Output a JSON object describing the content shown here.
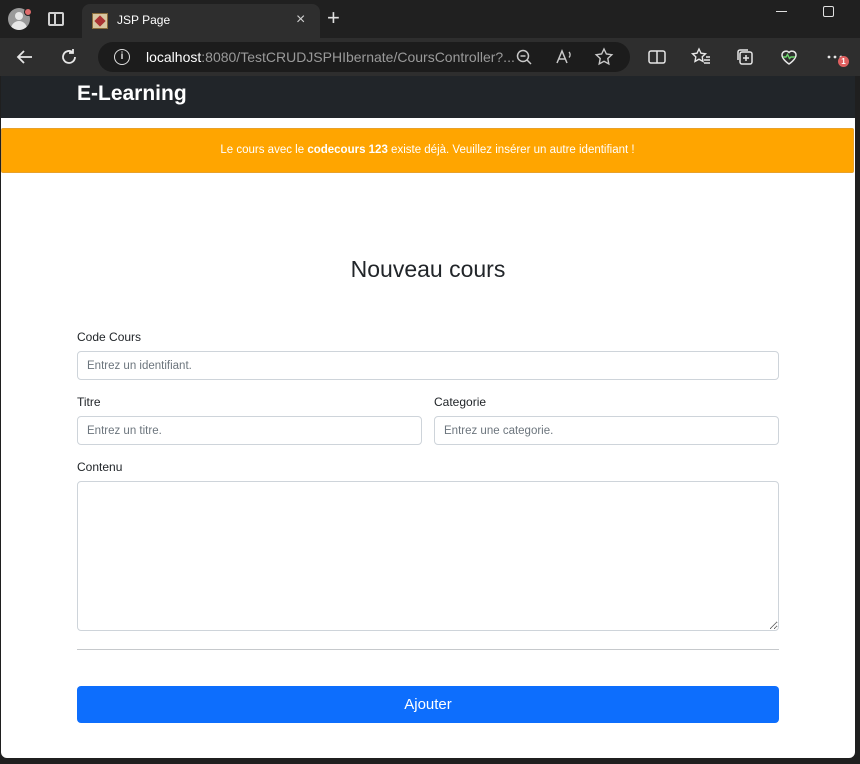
{
  "browser": {
    "tab_title": "JSP Page",
    "url_host": "localhost",
    "url_rest": ":8080/TestCRUDJSPHIbernate/CoursController?...",
    "new_tab_symbol": "+",
    "close_symbol": "×",
    "badge_count": "1"
  },
  "navbar": {
    "brand": "E-Learning"
  },
  "alert": {
    "prefix": "Le cours avec le ",
    "highlight": "codecours 123",
    "suffix": " existe déjà. Veuillez insérer un autre identifiant !",
    "color": "#ffa500"
  },
  "form": {
    "title": "Nouveau cours",
    "code": {
      "label": "Code Cours",
      "placeholder": "Entrez un identifiant.",
      "value": ""
    },
    "titre": {
      "label": "Titre",
      "placeholder": "Entrez un titre.",
      "value": ""
    },
    "categorie": {
      "label": "Categorie",
      "placeholder": "Entrez une categorie.",
      "value": ""
    },
    "contenu": {
      "label": "Contenu",
      "value": ""
    },
    "submit_label": "Ajouter",
    "submit_color": "#0d6efd"
  },
  "icons": [
    "profile-icon",
    "tab-actions-icon",
    "back-icon",
    "refresh-icon",
    "info-icon",
    "zoom-out-icon",
    "read-aloud-icon",
    "favorite-star-icon",
    "split-screen-icon",
    "favorites-icon",
    "collections-icon",
    "browser-essentials-icon",
    "more-icon"
  ]
}
